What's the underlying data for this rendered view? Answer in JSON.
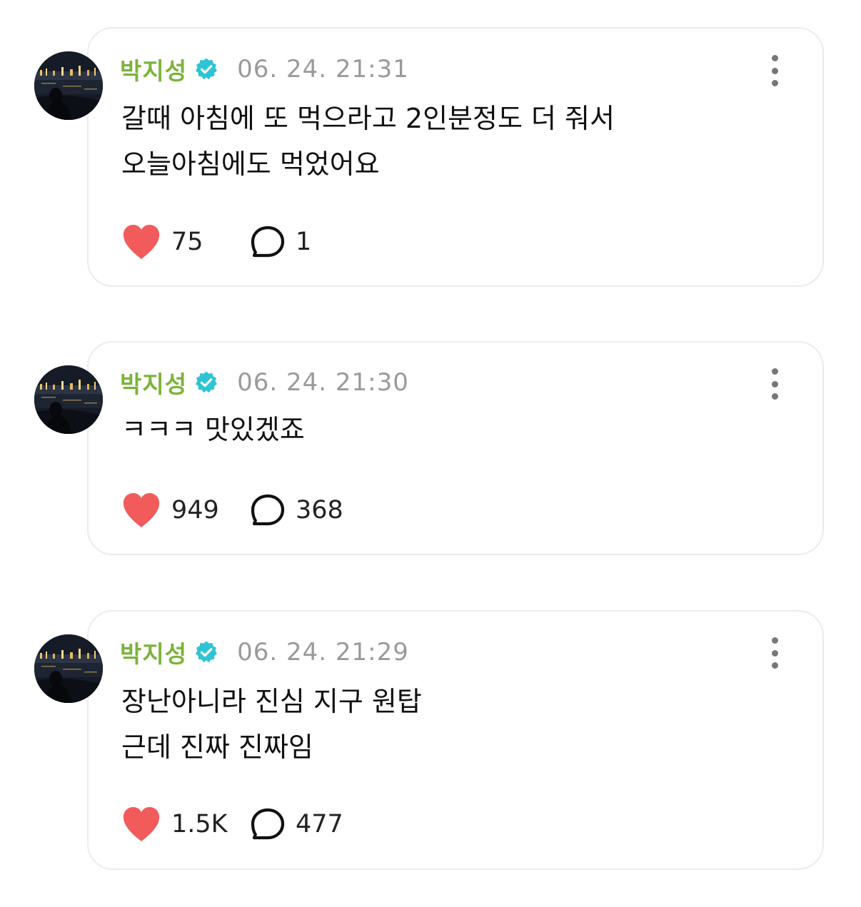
{
  "colors": {
    "name": "#7bb33a",
    "verified": "#2ec4d6",
    "heart": "#f15b5b",
    "time": "#9a9a9a"
  },
  "icons": {
    "verified": "verified-badge-icon",
    "like": "heart-icon",
    "reply": "speech-bubble-icon",
    "more": "more-vertical-icon"
  },
  "posts": [
    {
      "author": "박지성",
      "time": "06. 24. 21:31",
      "lines": [
        "갈때 아침에 또 먹으라고 2인분정도 더 줘서",
        "오늘아침에도 먹었어요"
      ],
      "likes": "75",
      "replies": "1"
    },
    {
      "author": "박지성",
      "time": "06. 24. 21:30",
      "lines": [
        "ㅋㅋㅋ 맛있겠죠"
      ],
      "likes": "949",
      "replies": "368"
    },
    {
      "author": "박지성",
      "time": "06. 24. 21:29",
      "lines": [
        "장난아니라 진심 지구 원탑",
        "근데 진짜 진짜임"
      ],
      "likes": "1.5K",
      "replies": "477"
    }
  ]
}
